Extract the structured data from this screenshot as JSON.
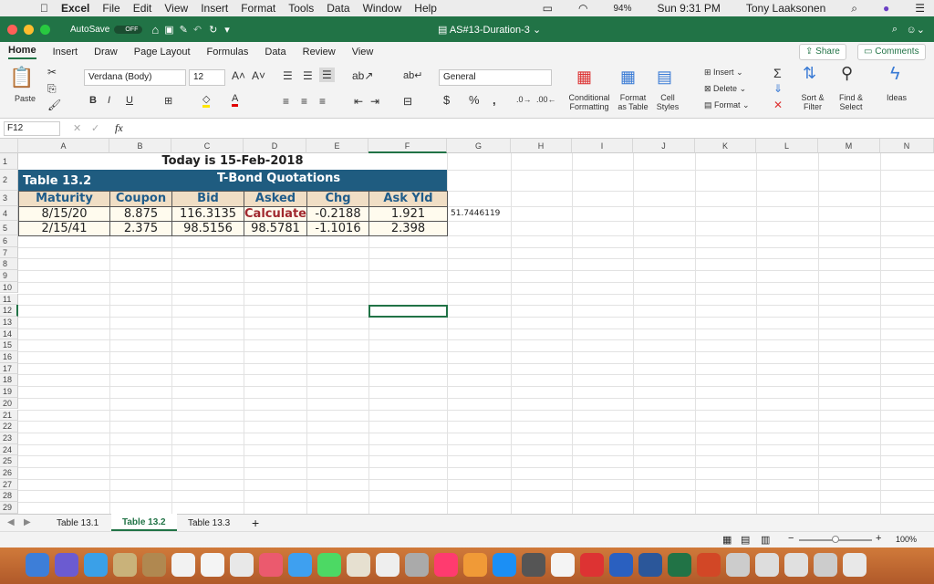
{
  "menubar": {
    "app": "Excel",
    "items": [
      "File",
      "Edit",
      "View",
      "Insert",
      "Format",
      "Tools",
      "Data",
      "Window",
      "Help"
    ],
    "battery": "94%",
    "clock": "Sun 9:31 PM",
    "user": "Tony Laaksonen"
  },
  "titlebar": {
    "autosave": "AutoSave",
    "autosave_state": "OFF",
    "doc": "AS#13-Duration-3"
  },
  "tabs": [
    "Home",
    "Insert",
    "Draw",
    "Page Layout",
    "Formulas",
    "Data",
    "Review",
    "View"
  ],
  "share": "Share",
  "comments": "Comments",
  "ribbon": {
    "paste": "Paste",
    "font": "Verdana (Body)",
    "size": "12",
    "number_format": "General",
    "cond": "Conditional Formatting",
    "fmt_table": "Format as Table",
    "cell_styles": "Cell Styles",
    "insert": "Insert",
    "delete": "Delete",
    "format": "Format",
    "sort": "Sort & Filter",
    "find": "Find & Select",
    "ideas": "Ideas",
    "bold": "B",
    "italic": "I",
    "underline": "U",
    "currency": "$",
    "percent": "%",
    "comma": ","
  },
  "formula_bar": {
    "name_box": "F12",
    "fx": "fx",
    "value": ""
  },
  "columns": [
    "A",
    "B",
    "C",
    "D",
    "E",
    "F",
    "G",
    "H",
    "I",
    "J",
    "K",
    "L",
    "M",
    "N"
  ],
  "sheet": {
    "title": "Today is 15-Feb-2018",
    "table_label": "Table 13.2",
    "table_title": "T-Bond Quotations",
    "headers": [
      "Maturity",
      "Coupon",
      "Bid",
      "Asked",
      "Chg",
      "Ask Yld"
    ],
    "rows": [
      [
        "8/15/20",
        "8.875",
        "116.3135",
        "Calculate",
        "-0.2188",
        "1.921"
      ],
      [
        "2/15/41",
        "2.375",
        "98.5156",
        "98.5781",
        "-1.1016",
        "2.398"
      ]
    ],
    "g4": "51.7446119",
    "selected": "F12"
  },
  "sheet_tabs": [
    "Table 13.1",
    "Table 13.2",
    "Table 13.3"
  ],
  "active_sheet": "Table 13.2",
  "zoom": "100%",
  "colors": {
    "excel_green": "#217346",
    "table_header": "#1f5c80",
    "col_header_fill": "#f0dec5",
    "calc_red": "#a0282e"
  }
}
